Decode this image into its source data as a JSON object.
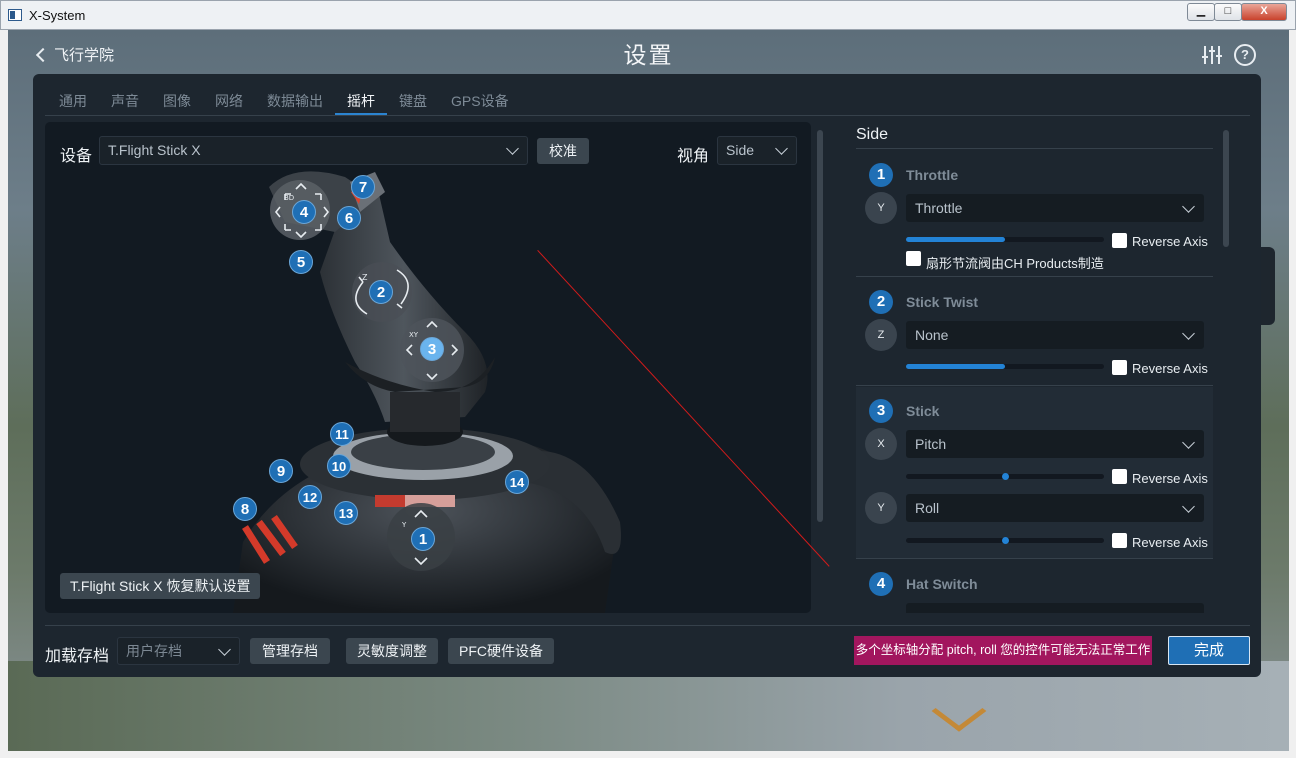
{
  "window": {
    "title": "X-System",
    "min": "▁",
    "max": "□",
    "close": "X"
  },
  "header": {
    "back_label": "飞行学院",
    "title": "设置"
  },
  "tabs": [
    "通用",
    "声音",
    "图像",
    "网络",
    "数据输出",
    "摇杆",
    "键盘",
    "GPS设备"
  ],
  "active_tab": "摇杆",
  "device": {
    "label": "设备",
    "selected": "T.Flight Stick X",
    "calibrate_label": "校准",
    "view_label": "视角",
    "view_selected": "Side",
    "restore_label": "T.Flight Stick X 恢复默认设置"
  },
  "badges": [
    "1",
    "2",
    "3",
    "4",
    "5",
    "6",
    "7",
    "8",
    "9",
    "10",
    "11",
    "12",
    "13",
    "14"
  ],
  "glyphs": {
    "bd": "BD",
    "z": "Z",
    "xy": "XY",
    "y": "Y"
  },
  "right": {
    "title": "Side",
    "cards": {
      "throttle": {
        "num": "1",
        "title": "Throttle",
        "icon_text": "Y",
        "selected": "Throttle",
        "reverse_label": "Reverse Axis",
        "level": 0.5,
        "ch_label": "扇形节流阀由CH Products制造"
      },
      "twist": {
        "num": "2",
        "title": "Stick Twist",
        "icon_text": "Z",
        "selected": "None",
        "reverse_label": "Reverse Axis",
        "level": 0.5
      },
      "stick": {
        "num": "3",
        "title": "Stick",
        "pitch": {
          "icon_text": "X",
          "selected": "Pitch",
          "reverse_label": "Reverse Axis",
          "level": 0.5
        },
        "roll": {
          "icon_text": "Y",
          "selected": "Roll",
          "reverse_label": "Reverse Axis",
          "level": 0.5
        }
      },
      "hat": {
        "num": "4",
        "title": "Hat Switch"
      }
    }
  },
  "footer": {
    "save_label": "加载存档",
    "save_placeholder": "用户存档",
    "manage_label": "管理存档",
    "sensitivity_label": "灵敏度调整",
    "pfc_label": "PFC硬件设备",
    "warning": "多个坐标轴分配 pitch, roll 您的控件可能无法正常工作",
    "done_label": "完成"
  },
  "colors": {
    "accent": "#1f6fb5",
    "warning_bg": "#a2165e",
    "panel": "#1d262f"
  }
}
